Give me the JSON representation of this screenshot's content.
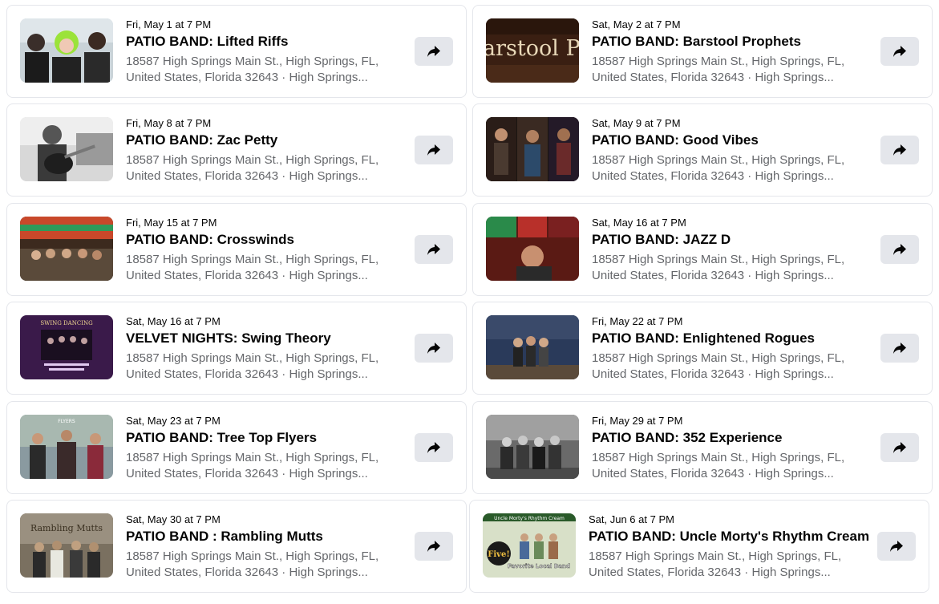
{
  "events": [
    {
      "date": "Fri, May 1 at 7 PM",
      "title": "PATIO BAND: Lifted Riffs",
      "addr1": "18587 High Springs Main St., High Springs, FL,",
      "addr2": "United States, Florida 32643 · High Springs..."
    },
    {
      "date": "Sat, May 2 at 7 PM",
      "title": "PATIO BAND: Barstool Prophets",
      "addr1": "18587 High Springs Main St., High Springs, FL,",
      "addr2": "United States, Florida 32643 · High Springs..."
    },
    {
      "date": "Fri, May 8 at 7 PM",
      "title": "PATIO BAND: Zac Petty",
      "addr1": "18587 High Springs Main St., High Springs, FL,",
      "addr2": "United States, Florida 32643 · High Springs..."
    },
    {
      "date": "Sat, May 9 at 7 PM",
      "title": "PATIO BAND: Good Vibes",
      "addr1": "18587 High Springs Main St., High Springs, FL,",
      "addr2": "United States, Florida 32643 · High Springs..."
    },
    {
      "date": "Fri, May 15 at 7 PM",
      "title": "PATIO BAND: Crosswinds",
      "addr1": "18587 High Springs Main St., High Springs, FL,",
      "addr2": "United States, Florida 32643 · High Springs..."
    },
    {
      "date": "Sat, May 16 at 7 PM",
      "title": "PATIO BAND: JAZZ D",
      "addr1": "18587 High Springs Main St., High Springs, FL,",
      "addr2": "United States, Florida 32643 · High Springs..."
    },
    {
      "date": "Sat, May 16 at 7 PM",
      "title": "VELVET NIGHTS: Swing Theory",
      "addr1": "18587 High Springs Main St., High Springs, FL,",
      "addr2": "United States, Florida 32643 · High Springs..."
    },
    {
      "date": "Fri, May 22 at 7 PM",
      "title": "PATIO BAND: Enlightened Rogues",
      "addr1": "18587 High Springs Main St., High Springs, FL,",
      "addr2": "United States, Florida 32643 · High Springs..."
    },
    {
      "date": "Sat, May 23 at 7 PM",
      "title": "PATIO BAND: Tree Top Flyers",
      "addr1": "18587 High Springs Main St., High Springs, FL,",
      "addr2": "United States, Florida 32643 · High Springs..."
    },
    {
      "date": "Fri, May 29 at 7 PM",
      "title": "PATIO BAND: 352 Experience",
      "addr1": "18587 High Springs Main St., High Springs, FL,",
      "addr2": "United States, Florida 32643 · High Springs..."
    },
    {
      "date": "Sat, May 30 at 7 PM",
      "title": "PATIO BAND : Rambling Mutts",
      "addr1": "18587 High Springs Main St., High Springs, FL,",
      "addr2": "United States, Florida 32643 · High Springs..."
    },
    {
      "date": "Sat, Jun 6 at 7 PM",
      "title": "PATIO BAND: Uncle Morty's Rhythm Cream",
      "addr1": "18587 High Springs Main St., High Springs, FL,",
      "addr2": "United States, Florida 32643 · High Springs..."
    }
  ],
  "thumb_text": {
    "barstool": "arstool Proph",
    "swing": "SWING DANCING",
    "flyers": "FLYERS",
    "rambling": "Rambling Mutts",
    "uncle": "Uncle Morty's Rhythm Cream",
    "five": "Five!",
    "favorite": "Favorite Local Band"
  }
}
